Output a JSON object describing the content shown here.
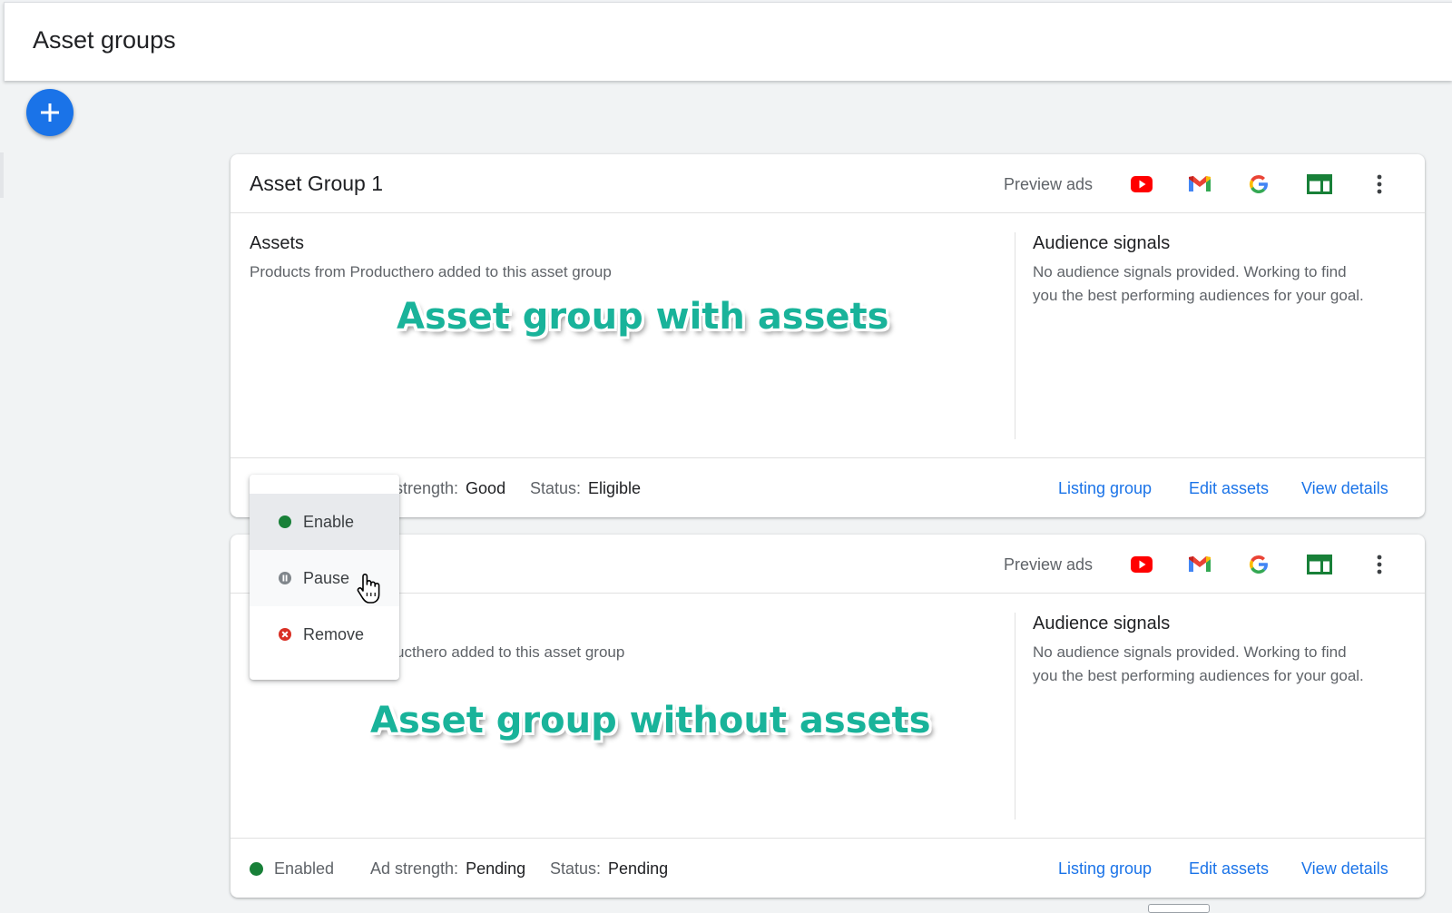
{
  "header": {
    "title": "Asset groups"
  },
  "fab": {
    "icon": "plus-icon"
  },
  "groups": [
    {
      "title": "Asset Group 1",
      "preview_label": "Preview ads",
      "preview_icons": [
        "youtube-icon",
        "gmail-icon",
        "google-icon",
        "display-icon",
        "more-vert-icon"
      ],
      "assets_title": "Assets",
      "assets_text": "Products from Producthero added to this asset group",
      "audience_title": "Audience signals",
      "audience_text": "No audience signals provided. Working to find you the best performing audiences for your goal.",
      "footer": {
        "ad_strength_label": "strength:",
        "ad_strength_value": "Good",
        "status_label": "Status:",
        "status_value": "Eligible"
      },
      "links": [
        "Listing group",
        "Edit assets",
        "View details"
      ]
    },
    {
      "title": "",
      "preview_label": "Preview ads",
      "preview_icons": [
        "youtube-icon",
        "gmail-icon",
        "google-icon",
        "display-icon",
        "more-vert-icon"
      ],
      "assets_title": "",
      "assets_text": "ucthero added to this asset group",
      "audience_title": "Audience signals",
      "audience_text": "No audience signals provided. Working to find you the best performing audiences for your goal.",
      "footer": {
        "state_value": "Enabled",
        "ad_strength_label": "Ad strength:",
        "ad_strength_value": "Pending",
        "status_label": "Status:",
        "status_value": "Pending"
      },
      "links": [
        "Listing group",
        "Edit assets",
        "View details"
      ]
    }
  ],
  "annotations": {
    "first": "Asset group with assets",
    "second": "Asset group without assets"
  },
  "status_menu": {
    "items": [
      {
        "label": "Enable",
        "icon": "green-dot-icon"
      },
      {
        "label": "Pause",
        "icon": "pause-icon"
      },
      {
        "label": "Remove",
        "icon": "remove-icon"
      }
    ]
  },
  "colors": {
    "accent": "#1a73e8",
    "enabled_green": "#188038",
    "remove_red": "#d93025",
    "annotation_teal": "#19b39a"
  }
}
